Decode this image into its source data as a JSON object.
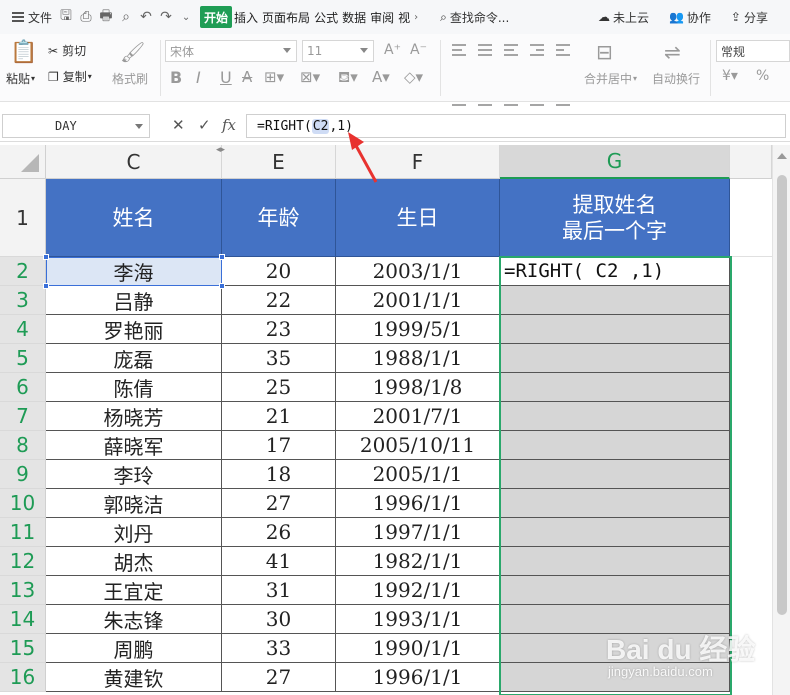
{
  "menu": {
    "file": "文件",
    "tabs": [
      "开始",
      "插入",
      "页面布局",
      "公式",
      "数据",
      "审阅",
      "视"
    ],
    "search": "查找命令...",
    "cloud": "未上云",
    "collab": "协作",
    "share": "分享"
  },
  "ribbon": {
    "paste": "粘贴",
    "cut": "剪切",
    "copy": "复制",
    "format_painter": "格式刷",
    "font_name": "宋体",
    "font_size": "11",
    "merge": "合并居中",
    "wrap": "自动换行",
    "number_format": "常规",
    "bold": "B",
    "italic": "I",
    "underline": "U"
  },
  "formula_bar": {
    "name_box": "DAY",
    "cancel": "✕",
    "confirm": "✓",
    "fx": "fx",
    "formula_prefix": "=RIGHT(",
    "formula_ref": "C2",
    "formula_suffix": ",1)"
  },
  "columns": [
    "C",
    "E",
    "F",
    "G"
  ],
  "header_row": {
    "row_label": "1",
    "name": "姓名",
    "age": "年龄",
    "birthday": "生日",
    "extract_line1": "提取姓名",
    "extract_line2": "最后一个字"
  },
  "rows": [
    {
      "n": "2",
      "name": "李海",
      "age": "20",
      "birthday": "2003/1/1"
    },
    {
      "n": "3",
      "name": "吕静",
      "age": "22",
      "birthday": "2001/1/1"
    },
    {
      "n": "4",
      "name": "罗艳丽",
      "age": "23",
      "birthday": "1999/5/1"
    },
    {
      "n": "5",
      "name": "庞磊",
      "age": "35",
      "birthday": "1988/1/1"
    },
    {
      "n": "6",
      "name": "陈倩",
      "age": "25",
      "birthday": "1998/1/8"
    },
    {
      "n": "7",
      "name": "杨晓芳",
      "age": "21",
      "birthday": "2001/7/1"
    },
    {
      "n": "8",
      "name": "薛晓军",
      "age": "17",
      "birthday": "2005/10/11"
    },
    {
      "n": "9",
      "name": "李玲",
      "age": "18",
      "birthday": "2005/1/1"
    },
    {
      "n": "10",
      "name": "郭晓洁",
      "age": "27",
      "birthday": "1996/1/1"
    },
    {
      "n": "11",
      "name": "刘丹",
      "age": "26",
      "birthday": "1997/1/1"
    },
    {
      "n": "12",
      "name": "胡杰",
      "age": "41",
      "birthday": "1982/1/1"
    },
    {
      "n": "13",
      "name": "王宜定",
      "age": "31",
      "birthday": "1992/1/1"
    },
    {
      "n": "14",
      "name": "朱志锋",
      "age": "30",
      "birthday": "1993/1/1"
    },
    {
      "n": "15",
      "name": "周鹏",
      "age": "33",
      "birthday": "1990/1/1"
    },
    {
      "n": "16",
      "name": "黄建钦",
      "age": "27",
      "birthday": "1996/1/1"
    }
  ],
  "active_cell_formula": "=RIGHT( C2 ,1)",
  "watermark": {
    "brand": "Bai du 经验",
    "url": "jingyan.baidu.com"
  },
  "colors": {
    "accent": "#1e9b55",
    "header_fill": "#4472c4",
    "ref": "#3a6fd8"
  }
}
